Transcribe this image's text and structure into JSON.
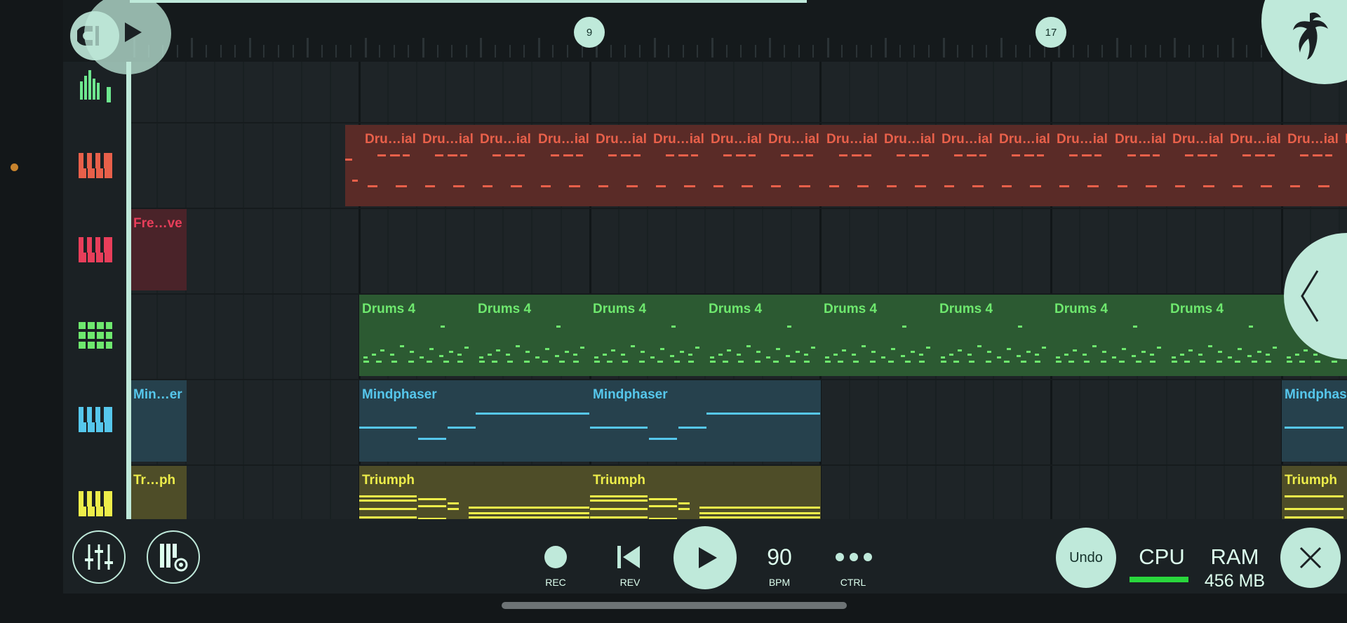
{
  "ruler": {
    "markers": [
      {
        "label": "9"
      },
      {
        "label": "17"
      }
    ]
  },
  "tracks": [
    {
      "name": "track-1-meters",
      "icon": "level-meter-icon",
      "color": "#6ee88f"
    },
    {
      "name": "track-2-keys",
      "icon": "piano-keys-icon",
      "color": "#e8604a"
    },
    {
      "name": "track-3-keys",
      "icon": "piano-keys-icon",
      "color": "#e83e5a"
    },
    {
      "name": "track-4-drums",
      "icon": "drum-pads-icon",
      "color": "#6ee86e"
    },
    {
      "name": "track-5-keys",
      "icon": "piano-keys-icon",
      "color": "#56c7ec"
    },
    {
      "name": "track-6-keys",
      "icon": "piano-keys-icon",
      "color": "#eded4a"
    }
  ],
  "clips": {
    "drums_red_label": "Dru…ial",
    "drums_red_label_cut": "D",
    "fre_label": "Fre…ve",
    "drums4_label": "Drums 4",
    "min_short_label": "Min…er",
    "mindphaser_label": "Mindphaser",
    "mindphaser_cut_label": "Mindphas",
    "tri_short_label": "Tr…ph",
    "triumph_label": "Triumph"
  },
  "toolbar": {
    "mixer_icon": "mixer-sliders-icon",
    "piano_settings_icon": "piano-settings-icon",
    "rec_label": "REC",
    "rev_label": "REV",
    "bpm_value": "90",
    "bpm_label": "BPM",
    "ctrl_label": "CTRL",
    "undo_label": "Undo",
    "cpu_label": "CPU",
    "ram_label": "RAM",
    "ram_value": "456 MB",
    "cpu_usage": 0.05
  },
  "colors": {
    "accent": "#bfe9da",
    "red": "#e8604a",
    "pink": "#e83e5a",
    "green": "#6ee86e",
    "blue": "#56c7ec",
    "yellow": "#eded4a"
  }
}
